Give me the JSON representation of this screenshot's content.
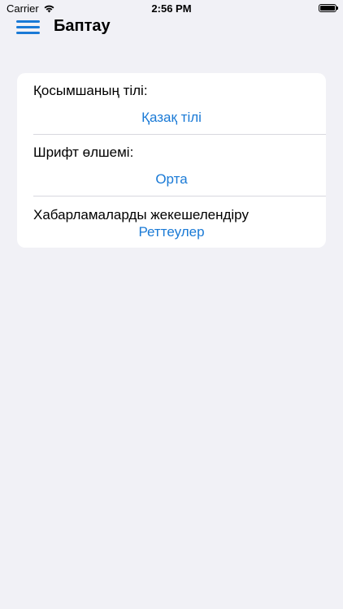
{
  "status_bar": {
    "carrier": "Carrier",
    "time": "2:56 PM",
    "wifi_icon": "wifi-icon",
    "battery_icon": "battery-icon"
  },
  "header": {
    "menu_icon": "hamburger-menu-icon",
    "title": "Баптау"
  },
  "settings": {
    "language": {
      "label": "Қосымшаның тілі:",
      "value": "Қазақ тілі"
    },
    "font_size": {
      "label": "Шрифт өлшемі:",
      "value": "Орта"
    },
    "notifications": {
      "label": "Хабарламаларды жекешелендіру",
      "value": "Реттеулер"
    }
  },
  "colors": {
    "accent": "#1a7ad6",
    "background": "#f1f1f6",
    "card": "#ffffff",
    "separator": "#d8d8de"
  }
}
